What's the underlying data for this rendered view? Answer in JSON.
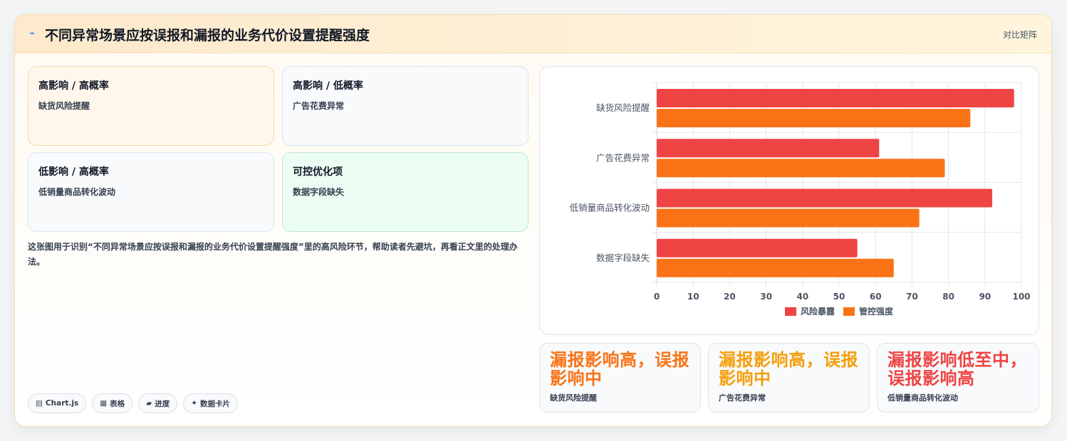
{
  "header": {
    "title": "不同异常场景应按误报和漏报的业务代价设置提醒强度",
    "link_label": "对比矩阵"
  },
  "quadrants": [
    {
      "title": "高影响 / 高概率",
      "subtitle": "缺货风险提醒"
    },
    {
      "title": "高影响 / 低概率",
      "subtitle": "广告花费异常"
    },
    {
      "title": "低影响 / 高概率",
      "subtitle": "低销量商品转化波动"
    },
    {
      "title": "可控优化项",
      "subtitle": "数据字段缺失"
    }
  ],
  "description": "这张图用于识别“不同异常场景应按误报和漏报的业务代价设置提醒强度”里的高风险环节，帮助读者先避坑，再看正文里的处理办法。",
  "tags": [
    {
      "icon": "▤",
      "icon_name": "chart-icon",
      "label": "Chart.js"
    },
    {
      "icon": "▦",
      "icon_name": "table-icon",
      "label": "表格"
    },
    {
      "icon": "▰",
      "icon_name": "progress-icon",
      "label": "进度"
    },
    {
      "icon": "✦",
      "icon_name": "sparkle-icon",
      "label": "数据卡片"
    }
  ],
  "chart_data": {
    "type": "bar",
    "orientation": "horizontal",
    "categories": [
      "缺货风险提醒",
      "广告花费异常",
      "低销量商品转化波动",
      "数据字段缺失"
    ],
    "series": [
      {
        "name": "风险暴露",
        "color": "#ef4444",
        "values": [
          98,
          61,
          92,
          55
        ]
      },
      {
        "name": "管控强度",
        "color": "#f97316",
        "values": [
          86,
          79,
          72,
          65
        ]
      }
    ],
    "xlim": [
      0,
      100
    ],
    "xticks": [
      "0",
      "10",
      "20",
      "30",
      "40",
      "50",
      "60",
      "70",
      "80",
      "90",
      "100"
    ],
    "grid": true,
    "legend_position": "bottom"
  },
  "stats": [
    {
      "big": "漏报影响高，误报影响中",
      "label": "缺货风险提醒",
      "color": "#f97316"
    },
    {
      "big": "漏报影响高，误报影响中",
      "label": "广告花费异常",
      "color": "#f59e0b"
    },
    {
      "big": "漏报影响低至中，误报影响高",
      "label": "低销量商品转化波动",
      "color": "#ef4444"
    }
  ]
}
